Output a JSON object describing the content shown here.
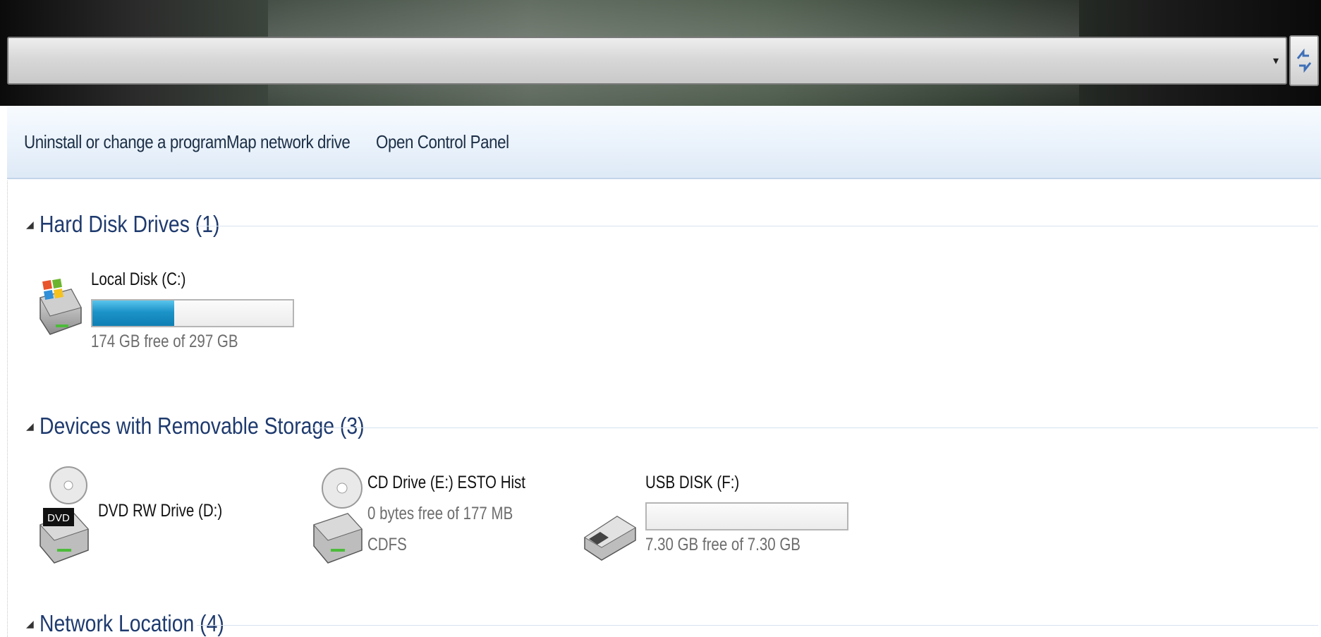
{
  "address_bar": {
    "value": "",
    "dropdown_icon": "chevron-down-icon",
    "refresh_icon": "refresh-icon"
  },
  "toolbar": {
    "buttons": [
      {
        "label": "Uninstall or change a program"
      },
      {
        "label": "Map network drive"
      },
      {
        "label": "Open Control Panel"
      }
    ]
  },
  "groups": {
    "hard_disk": {
      "title": "Hard Disk Drives (1)",
      "drives": [
        {
          "name": "Local Disk (C:)",
          "detail": "174 GB free of 297 GB",
          "used_fraction": 0.41,
          "icon": "windows-hard-disk-icon"
        }
      ]
    },
    "removable": {
      "title": "Devices with Removable Storage (3)",
      "drives": [
        {
          "name": "DVD RW Drive (D:)",
          "icon": "dvd-drive-icon",
          "badge": "DVD"
        },
        {
          "name": "CD Drive (E:) ESTO Hist",
          "detail": "0 bytes free of 177 MB",
          "filesystem": "CDFS",
          "icon": "cd-drive-icon"
        },
        {
          "name": "USB DISK (F:)",
          "detail": "7.30 GB free of 7.30 GB",
          "used_fraction": 0.0,
          "icon": "usb-drive-icon"
        }
      ]
    },
    "network": {
      "title": "Network Location (4)"
    }
  },
  "colors": {
    "toolbar_text": "#1c2f46",
    "group_title": "#1e3a6e",
    "capacity_fill": "#1c93c8"
  }
}
